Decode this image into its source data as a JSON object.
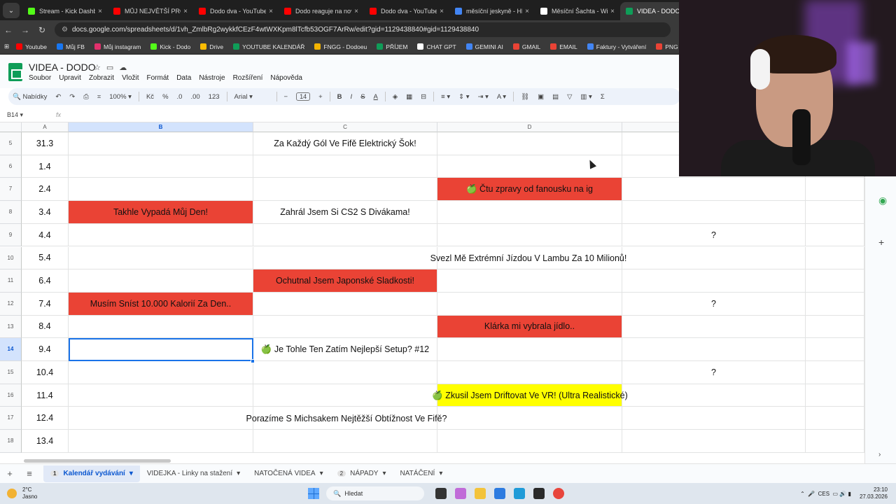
{
  "browser": {
    "tabs": [
      {
        "label": "Stream - Kick Dashb",
        "color": "#53fc18"
      },
      {
        "label": "MŮJ NEJVĚTŠÍ PROJE",
        "color": "#ff0000"
      },
      {
        "label": "Dodo dva - YouTube",
        "color": "#ff0000"
      },
      {
        "label": "Dodo reaguje na nov",
        "color": "#ff0000"
      },
      {
        "label": "Dodo dva - YouTube",
        "color": "#ff0000"
      },
      {
        "label": "měsíční jeskyně - Hle",
        "color": "#4285f4"
      },
      {
        "label": "Měsíční Šachta - Wik",
        "color": "#ffffff"
      },
      {
        "label": "VIDEA - DODO -",
        "color": "#0f9d58"
      }
    ],
    "url": "docs.google.com/spreadsheets/d/1vh_ZmlbRg2wykkfCEzF4wtWXKpm8lTcfb53OGF7ArRw/edit?gid=1129438840#gid=1129438840",
    "bookmarks": [
      {
        "label": "Youtube",
        "color": "#ff0000"
      },
      {
        "label": "Můj FB",
        "color": "#1877f2"
      },
      {
        "label": "Můj instagram",
        "color": "#e1306c"
      },
      {
        "label": "Kick - Dodo",
        "color": "#53fc18"
      },
      {
        "label": "Drive",
        "color": "#fbbc04"
      },
      {
        "label": "YOUTUBE KALENDÁŘ",
        "color": "#0f9d58"
      },
      {
        "label": "FNGG - Dodoeu",
        "color": "#f4b400"
      },
      {
        "label": "PŘÍJEM",
        "color": "#0f9d58"
      },
      {
        "label": "CHAT GPT",
        "color": "#ffffff"
      },
      {
        "label": "GEMINI AI",
        "color": "#4285f4"
      },
      {
        "label": "GMAIL",
        "color": "#ea4335"
      },
      {
        "label": "EMAIL",
        "color": "#ea4335"
      },
      {
        "label": "Faktury - Vytváření",
        "color": "#4285f4"
      },
      {
        "label": "PNG to PDF",
        "color": "#ea4335"
      }
    ]
  },
  "sheets": {
    "title": "VIDEA - DODO",
    "menu": [
      "Soubor",
      "Upravit",
      "Zobrazit",
      "Vložit",
      "Formát",
      "Data",
      "Nástroje",
      "Rozšíření",
      "Nápověda"
    ],
    "toolbar": {
      "search": "Nabídky",
      "zoom": "100%",
      "currency": "Kč",
      "percent": "%",
      "dec_minus": ".0",
      "dec_plus": ".00",
      "number": "123",
      "font": "Arial",
      "font_size": "14"
    },
    "name_box": "B14",
    "columns": [
      "A",
      "B",
      "C",
      "D"
    ],
    "rows": [
      {
        "num": "5",
        "a": "31.3",
        "b": "",
        "c": "Za Každý Gól Ve Fifě Elektrický Šok!",
        "d": "",
        "e": ""
      },
      {
        "num": "6",
        "a": "1.4",
        "b": "",
        "c": "",
        "d": "",
        "e": ""
      },
      {
        "num": "7",
        "a": "2.4",
        "b": "",
        "c": "",
        "d": "🍏 Čtu zpravy od fanousku na ig",
        "e": ""
      },
      {
        "num": "8",
        "a": "3.4",
        "b": "Takhle Vypadá Můj Den!",
        "c": "Zahrál Jsem Si CS2 S Divákama!",
        "d": "",
        "e": ""
      },
      {
        "num": "9",
        "a": "4.4",
        "b": "",
        "c": "",
        "d": "",
        "e": "?"
      },
      {
        "num": "10",
        "a": "5.4",
        "b": "",
        "c": "",
        "d": "Svezl Mě Extrémní Jízdou V Lambu Za 10 Milionů!",
        "e": ""
      },
      {
        "num": "11",
        "a": "6.4",
        "b": "",
        "c": "Ochutnal Jsem Japonské Sladkosti!",
        "d": "",
        "e": ""
      },
      {
        "num": "12",
        "a": "7.4",
        "b": "Musím Sníst 10.000 Kalorií Za Den..",
        "c": "",
        "d": "",
        "e": "?"
      },
      {
        "num": "13",
        "a": "8.4",
        "b": "",
        "c": "",
        "d": "Klárka mi vybrala jídlo..",
        "e": ""
      },
      {
        "num": "14",
        "a": "9.4",
        "b": "",
        "c": "🍏 Je Tohle Ten Zatím Nejlepší Setup? #12",
        "d": "",
        "e": ""
      },
      {
        "num": "15",
        "a": "10.4",
        "b": "",
        "c": "",
        "d": "",
        "e": "?"
      },
      {
        "num": "16",
        "a": "11.4",
        "b": "",
        "c": "",
        "d": "🍏 Zkusil Jsem Driftovat Ve VR! (Ultra Realistické)",
        "e": ""
      },
      {
        "num": "17",
        "a": "12.4",
        "b": "",
        "c": "Porazíme S Michsakem Nejtěžší Obtížnost Ve Fifě?",
        "d": "",
        "e": ""
      },
      {
        "num": "18",
        "a": "13.4",
        "b": "",
        "c": "",
        "d": "",
        "e": ""
      }
    ],
    "sheet_tabs": [
      {
        "badge": "1",
        "label": "Kalendář vydávání",
        "active": true
      },
      {
        "badge": "",
        "label": "VIDEJKA - Linky na stažení",
        "active": false
      },
      {
        "badge": "",
        "label": "NATOČENÁ VIDEA",
        "active": false
      },
      {
        "badge": "2",
        "label": "NÁPADY",
        "active": false
      },
      {
        "badge": "",
        "label": "NATÁČENÍ",
        "active": false
      }
    ],
    "colors": {
      "red": "#ea4335",
      "yellow": "#ffff00",
      "selection": "#1a73e8"
    }
  },
  "taskbar": {
    "temp": "2°C",
    "weather": "Jasno",
    "search": "Hledat",
    "lang": "CES",
    "time": "23:10",
    "date": "27.03.2026"
  }
}
